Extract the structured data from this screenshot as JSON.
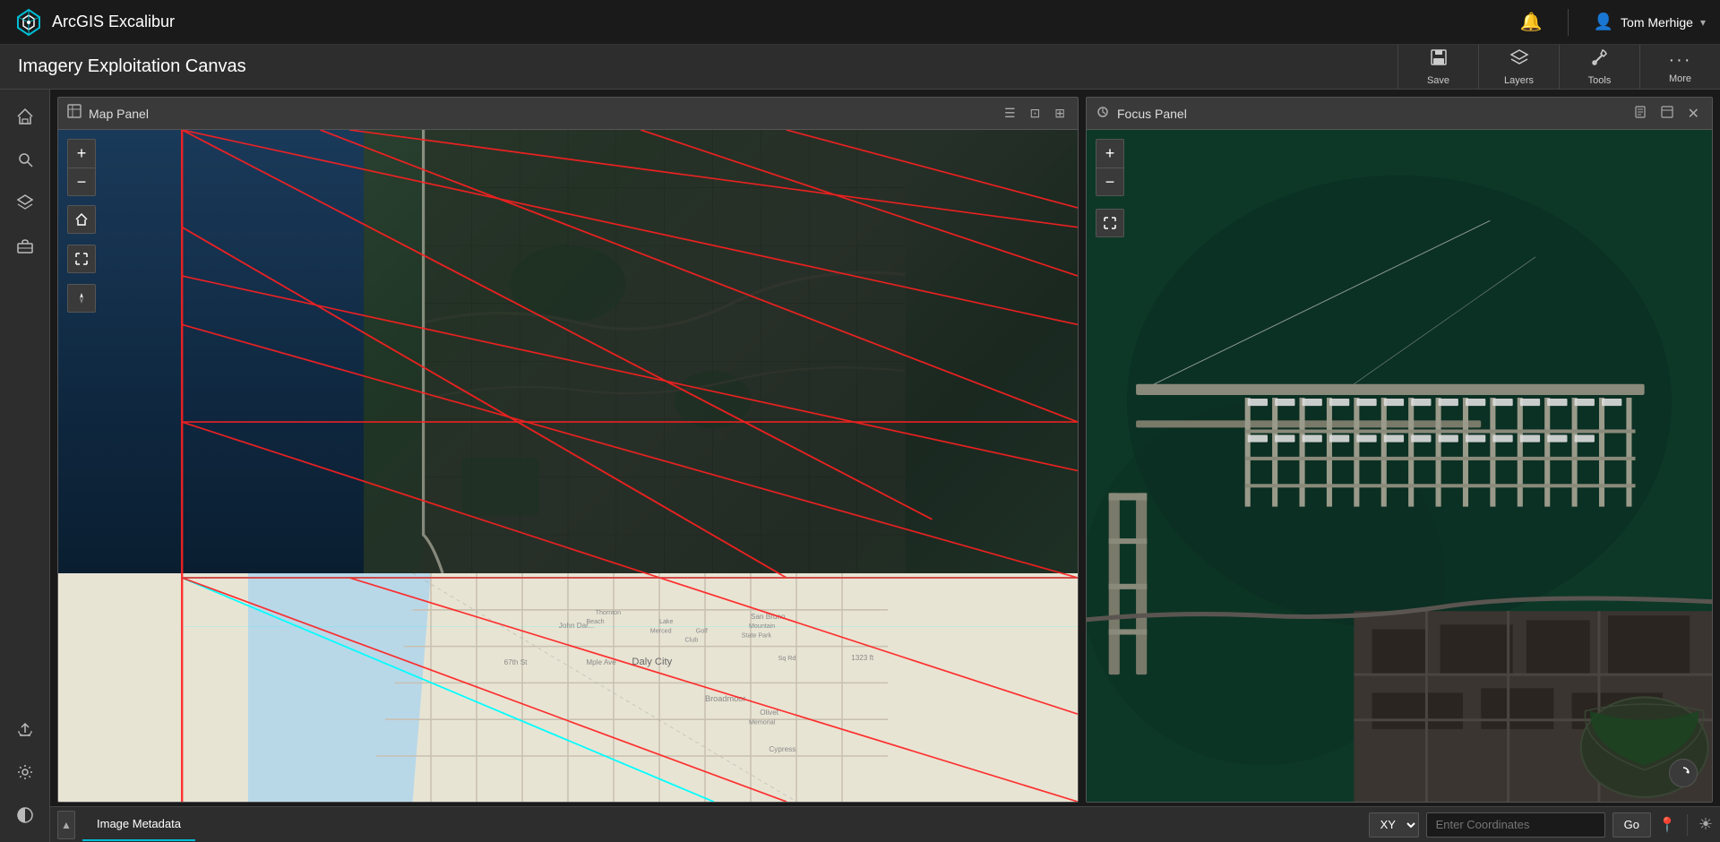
{
  "app": {
    "title": "ArcGIS Excalibur",
    "page_title": "Imagery Exploitation Canvas"
  },
  "header": {
    "notification_label": "🔔",
    "user_name": "Tom Merhige",
    "user_chevron": "▾"
  },
  "toolbar": {
    "save_label": "Save",
    "layers_label": "Layers",
    "tools_label": "Tools",
    "more_label": "More"
  },
  "sidebar": {
    "home_label": "⌂",
    "search_label": "🔍",
    "layers_label": "≡",
    "briefcase_label": "💼",
    "upload_label": "↑",
    "settings_label": "⚙",
    "theme_label": "◑"
  },
  "map_panel": {
    "title": "Map Panel",
    "zoom_in": "+",
    "zoom_out": "−"
  },
  "focus_panel": {
    "title": "Focus Panel",
    "zoom_in": "+",
    "zoom_out": "−"
  },
  "bottom_bar": {
    "collapse_label": "▲",
    "tab_label": "Image Metadata",
    "coord_mode": "XY",
    "coord_placeholder": "Enter Coordinates",
    "go_label": "Go"
  }
}
